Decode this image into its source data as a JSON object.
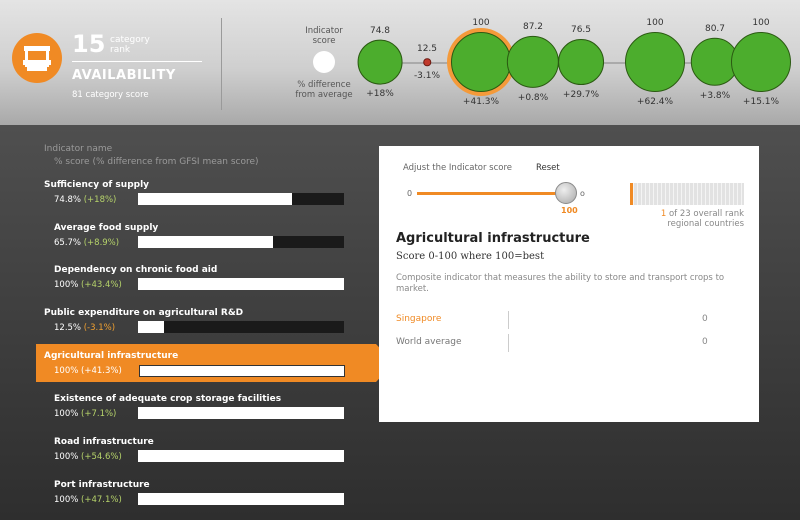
{
  "header": {
    "rank_value": "15",
    "rank_label_line1": "category",
    "rank_label_line2": "rank",
    "category_title": "AVAILABILITY",
    "category_score": "81 category score",
    "indicator_label_line1": "Indicator",
    "indicator_label_line2": "score",
    "diff_label_line1": "% difference",
    "diff_label_line2": "from average"
  },
  "bubbles": [
    {
      "value": "74.8",
      "diff": "+18%",
      "status": "green"
    },
    {
      "value": "12.5",
      "diff": "-3.1%",
      "status": "red"
    },
    {
      "value": "100",
      "diff": "+41.3%",
      "status": "green",
      "selected": true
    },
    {
      "value": "87.2",
      "diff": "+0.8%",
      "status": "green"
    },
    {
      "value": "76.5",
      "diff": "+29.7%",
      "status": "green"
    },
    {
      "value": "100",
      "diff": "+62.4%",
      "status": "green"
    },
    {
      "value": "80.7",
      "diff": "+3.8%",
      "status": "green"
    },
    {
      "value": "100",
      "diff": "+15.1%",
      "status": "green"
    }
  ],
  "list": {
    "head1": "Indicator name",
    "head2": "% score (% difference from GFSI mean score)",
    "items": [
      {
        "name": "Sufficiency of supply",
        "score": "74.8%",
        "diff": "(+18%)",
        "level": 0.748
      },
      {
        "name": "Average food supply",
        "score": "65.7%",
        "diff": "(+8.9%)",
        "level": 0.657
      },
      {
        "name": "Dependency on chronic food aid",
        "score": "100%",
        "diff": "(+43.4%)",
        "level": 1.0
      },
      {
        "name": "Public expenditure on agricultural R&D",
        "score": "12.5%",
        "diff": "(-3.1%)",
        "level": 0.125
      },
      {
        "name": "Agricultural infrastructure",
        "score": "100%",
        "diff": "(+41.3%)",
        "level": 1.0
      },
      {
        "name": "Existence of adequate crop storage facilities",
        "score": "100%",
        "diff": "(+7.1%)",
        "level": 1.0
      },
      {
        "name": "Road infrastructure",
        "score": "100%",
        "diff": "(+54.6%)",
        "level": 1.0
      },
      {
        "name": "Port infrastructure",
        "score": "100%",
        "diff": "(+47.1%)",
        "level": 1.0
      }
    ]
  },
  "panel": {
    "adjust_label": "Adjust the Indicator score",
    "reset_label": "Reset",
    "slider_min": "0",
    "slider_value": "100",
    "slider_level": 1.0,
    "rank_text_num": "1",
    "rank_text_rest": "of 23 overall rank",
    "rank_text_line2": "regional countries",
    "title": "Agricultural infrastructure",
    "subtitle": "Score 0-100 where 100=best",
    "description": "Composite indicator that measures the ability to store and transport crops to market.",
    "rows": [
      {
        "name": "Singapore",
        "value": "0"
      },
      {
        "name": "World average",
        "value": "0"
      }
    ]
  },
  "colors": {
    "accent": "#f08a24",
    "positive": "#4cad2d",
    "negative": "#c0392b",
    "diff_text": "#b6d36a"
  },
  "icons": {
    "category": "market-stall-icon"
  }
}
